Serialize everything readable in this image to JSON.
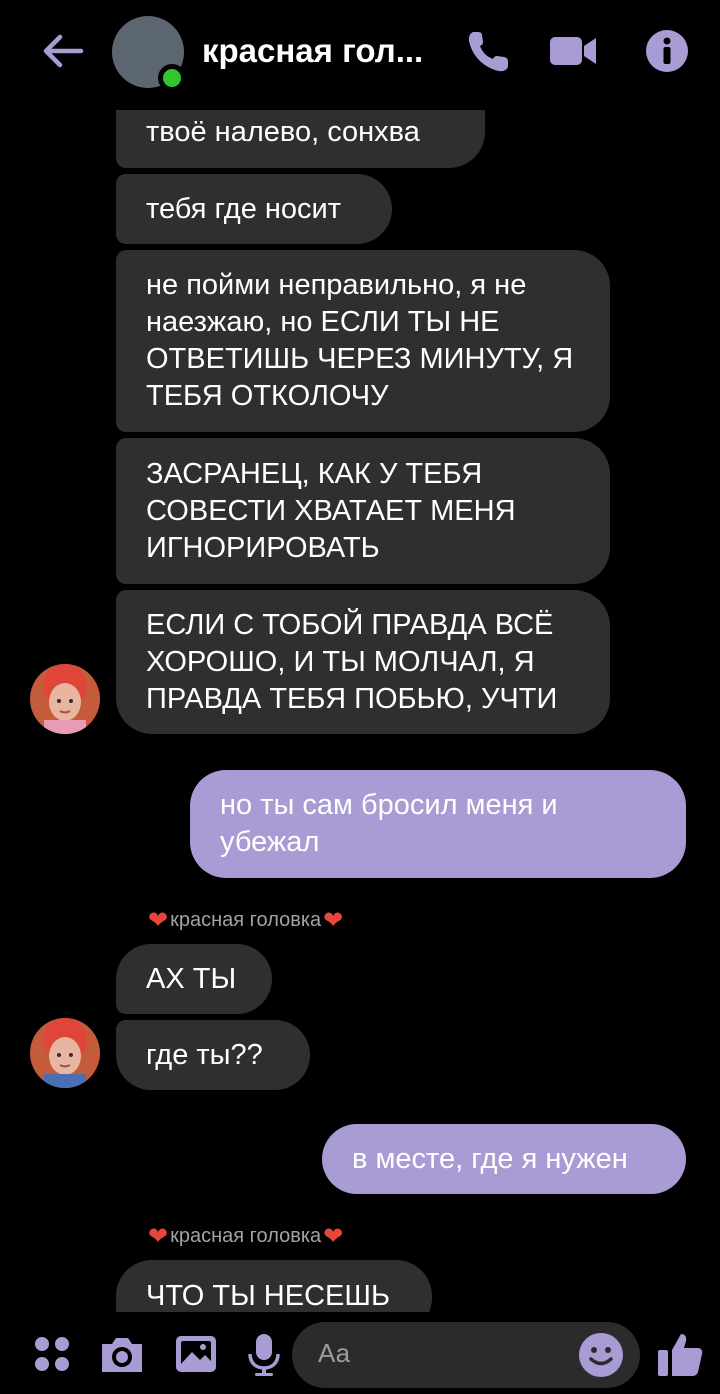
{
  "header": {
    "title": "красная гол...",
    "back_icon": "arrow-left-icon",
    "call_icon": "phone-icon",
    "video_icon": "video-camera-icon",
    "info_icon": "info-icon",
    "status": "online"
  },
  "messages": [
    {
      "dir": "in",
      "text": "твоё налево, сонхва"
    },
    {
      "dir": "in",
      "text": "тебя где носит"
    },
    {
      "dir": "in",
      "text": "не пойми неправильно, я не наезжаю, но ЕСЛИ ТЫ НЕ ОТВЕТИШЬ ЧЕРЕЗ МИНУТУ, Я ТЕБЯ ОТКОЛОЧУ"
    },
    {
      "dir": "in",
      "text": "ЗАСРАНЕЦ, КАК У ТЕБЯ СОВЕСТИ ХВАТАЕТ МЕНЯ ИГНОРИРОВАТЬ"
    },
    {
      "dir": "in",
      "text": "ЕСЛИ С ТОБОЙ ПРАВДА ВСЁ ХОРОШО, И ТЫ МОЛЧАЛ, Я ПРАВДА ТЕБЯ ПОБЬЮ, УЧТИ"
    },
    {
      "dir": "out",
      "text": "но ты сам бросил меня и убежал"
    },
    {
      "dir": "in",
      "text": "АХ ТЫ"
    },
    {
      "dir": "in",
      "text": "где ты??"
    },
    {
      "dir": "out",
      "text": "в месте, где я нужен"
    },
    {
      "dir": "in",
      "text": "ЧТО ТЫ НЕСЕШЬ"
    }
  ],
  "sender_name": "красная головка",
  "composer": {
    "placeholder": "Аа",
    "icons": [
      "grid-menu-icon",
      "camera-icon",
      "gallery-icon",
      "microphone-icon",
      "emoji-icon",
      "thumbs-up-icon"
    ]
  },
  "colors": {
    "background": "#000000",
    "incoming_bubble": "#2f2f31",
    "outgoing_bubble": "#a99cd4",
    "accent": "#a99cd4",
    "online": "#31c530"
  }
}
